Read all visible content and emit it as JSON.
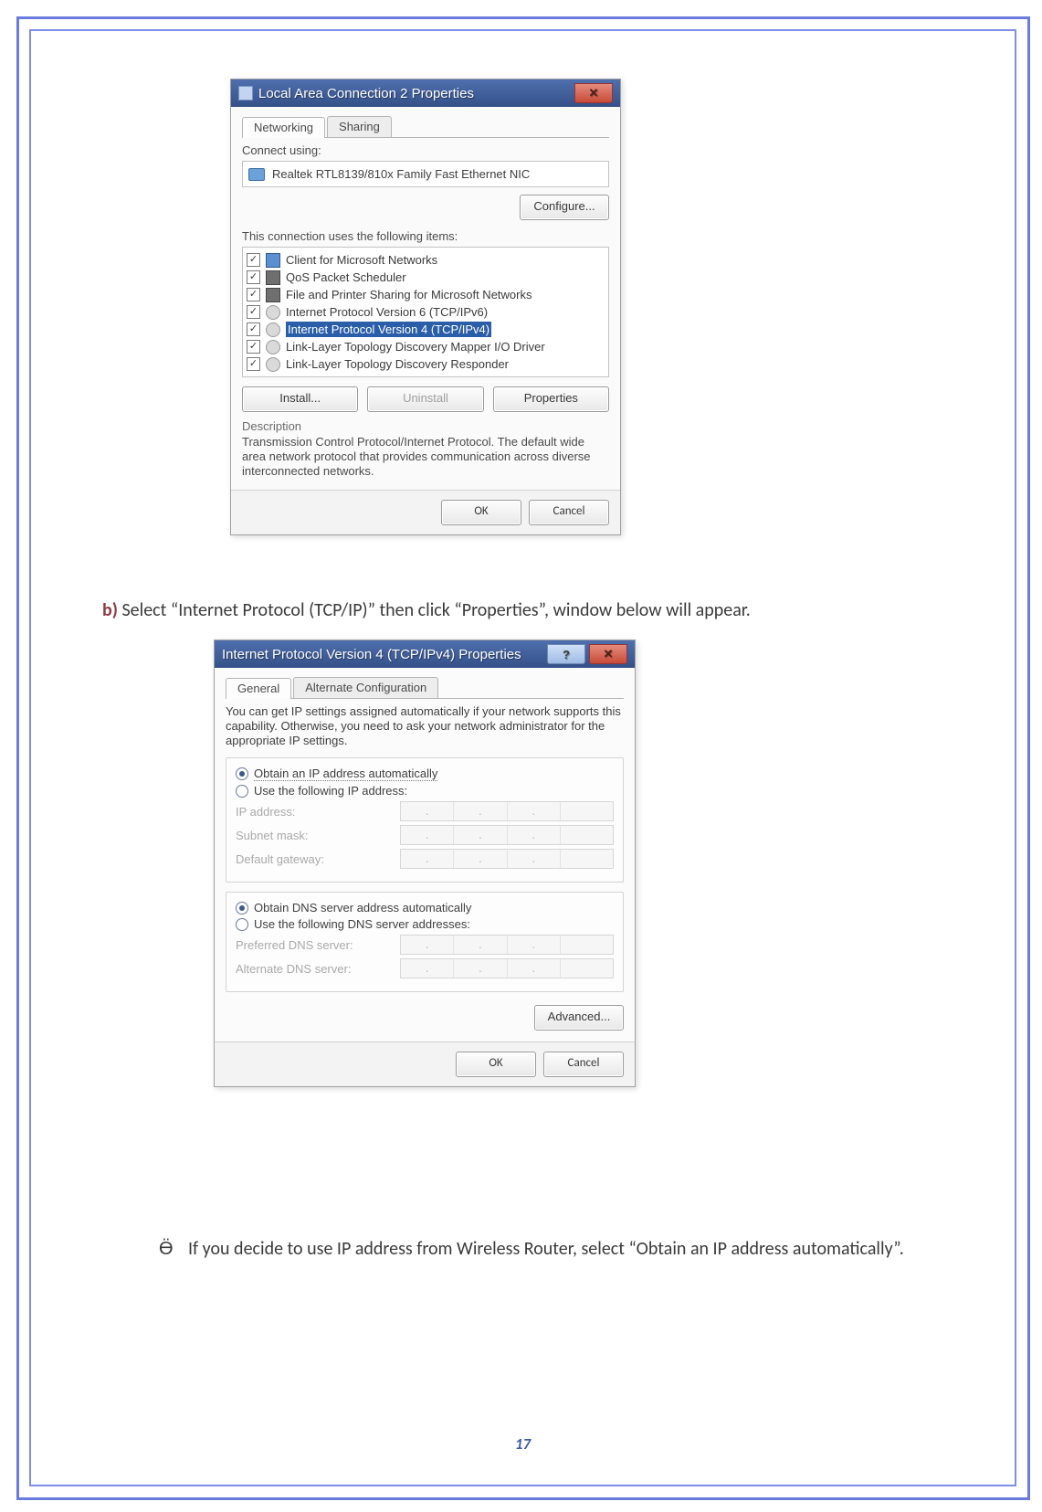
{
  "page_number": "17",
  "dialog1": {
    "title": "Local Area Connection 2 Properties",
    "tabs": {
      "networking": "Networking",
      "sharing": "Sharing"
    },
    "connect_using_label": "Connect using:",
    "adapter": "Realtek RTL8139/810x Family Fast Ethernet NIC",
    "configure_btn": "Configure...",
    "items_label": "This connection uses the following items:",
    "items": [
      {
        "checked": true,
        "icon": "ic-net",
        "label": "Client for Microsoft Networks"
      },
      {
        "checked": true,
        "icon": "ic-qos",
        "label": "QoS Packet Scheduler"
      },
      {
        "checked": true,
        "icon": "ic-file",
        "label": "File and Printer Sharing for Microsoft Networks"
      },
      {
        "checked": true,
        "icon": "ic-link",
        "label": "Internet Protocol Version 6 (TCP/IPv6)"
      },
      {
        "checked": true,
        "icon": "ic-link",
        "label": "Internet Protocol Version 4 (TCP/IPv4)",
        "selected": true
      },
      {
        "checked": true,
        "icon": "ic-link",
        "label": "Link-Layer Topology Discovery Mapper I/O Driver"
      },
      {
        "checked": true,
        "icon": "ic-link",
        "label": "Link-Layer Topology Discovery Responder"
      }
    ],
    "install_btn": "Install...",
    "uninstall_btn": "Uninstall",
    "properties_btn": "Properties",
    "desc_title": "Description",
    "desc_text": "Transmission Control Protocol/Internet Protocol. The default wide area network protocol that provides communication across diverse interconnected networks.",
    "ok_btn": "OK",
    "cancel_btn": "Cancel"
  },
  "para_b": {
    "marker": "b) ",
    "text": "Select “Internet Protocol (TCP/IP)” then click “Properties”, window below will appear."
  },
  "dialog2": {
    "title": "Internet Protocol Version 4 (TCP/IPv4) Properties",
    "tabs": {
      "general": "General",
      "alt": "Alternate Configuration"
    },
    "intro": "You can get IP settings assigned automatically if your network supports this capability. Otherwise, you need to ask your network administrator for the appropriate IP settings.",
    "ip_auto": "Obtain an IP address automatically",
    "ip_manual": "Use the following IP address:",
    "ip_label": "IP address:",
    "mask_label": "Subnet mask:",
    "gw_label": "Default gateway:",
    "dns_auto": "Obtain DNS server address automatically",
    "dns_manual": "Use the following DNS server addresses:",
    "pref_dns": "Preferred DNS server:",
    "alt_dns": "Alternate DNS server:",
    "advanced_btn": "Advanced...",
    "ok_btn": "OK",
    "cancel_btn": "Cancel"
  },
  "bullet": {
    "marker": "Ӫ",
    "text": "If you decide to use IP address from Wireless Router, select “Obtain an IP address automatically”."
  }
}
